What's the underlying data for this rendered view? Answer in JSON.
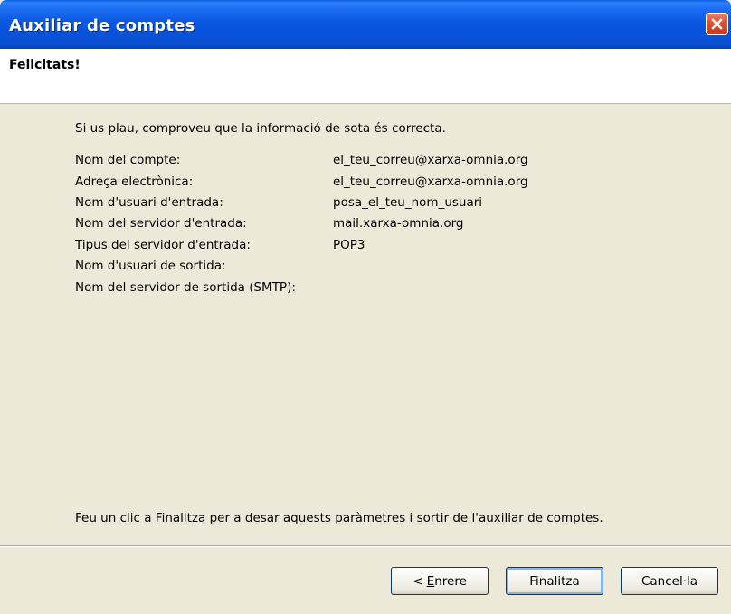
{
  "window": {
    "title": "Auxiliar de comptes",
    "close_icon": "close-icon"
  },
  "header": {
    "title": "Felicitats!"
  },
  "main": {
    "intro": "Si us plau, comproveu que la informació de sota és correcta.",
    "rows": [
      {
        "label": "Nom del compte:",
        "value": "el_teu_correu@xarxa-omnia.org"
      },
      {
        "label": "Adreça electrònica:",
        "value": "el_teu_correu@xarxa-omnia.org"
      },
      {
        "label": "Nom d'usuari d'entrada:",
        "value": "posa_el_teu_nom_usuari"
      },
      {
        "label": "Nom del servidor d'entrada:",
        "value": "mail.xarxa-omnia.org"
      },
      {
        "label": "Tipus del servidor d'entrada:",
        "value": "POP3"
      },
      {
        "label": "Nom d'usuari de sortida:",
        "value": ""
      },
      {
        "label": "Nom del servidor de sortida (SMTP):",
        "value": ""
      }
    ],
    "finish_note": "Feu un clic a Finalitza per a desar aquests paràmetres i sortir de l'auxiliar de comptes."
  },
  "footer": {
    "back_prefix": "< ",
    "back_accel": "E",
    "back_rest": "nrere",
    "finish_label": "Finalitza",
    "cancel_label": "Cancel·la"
  }
}
